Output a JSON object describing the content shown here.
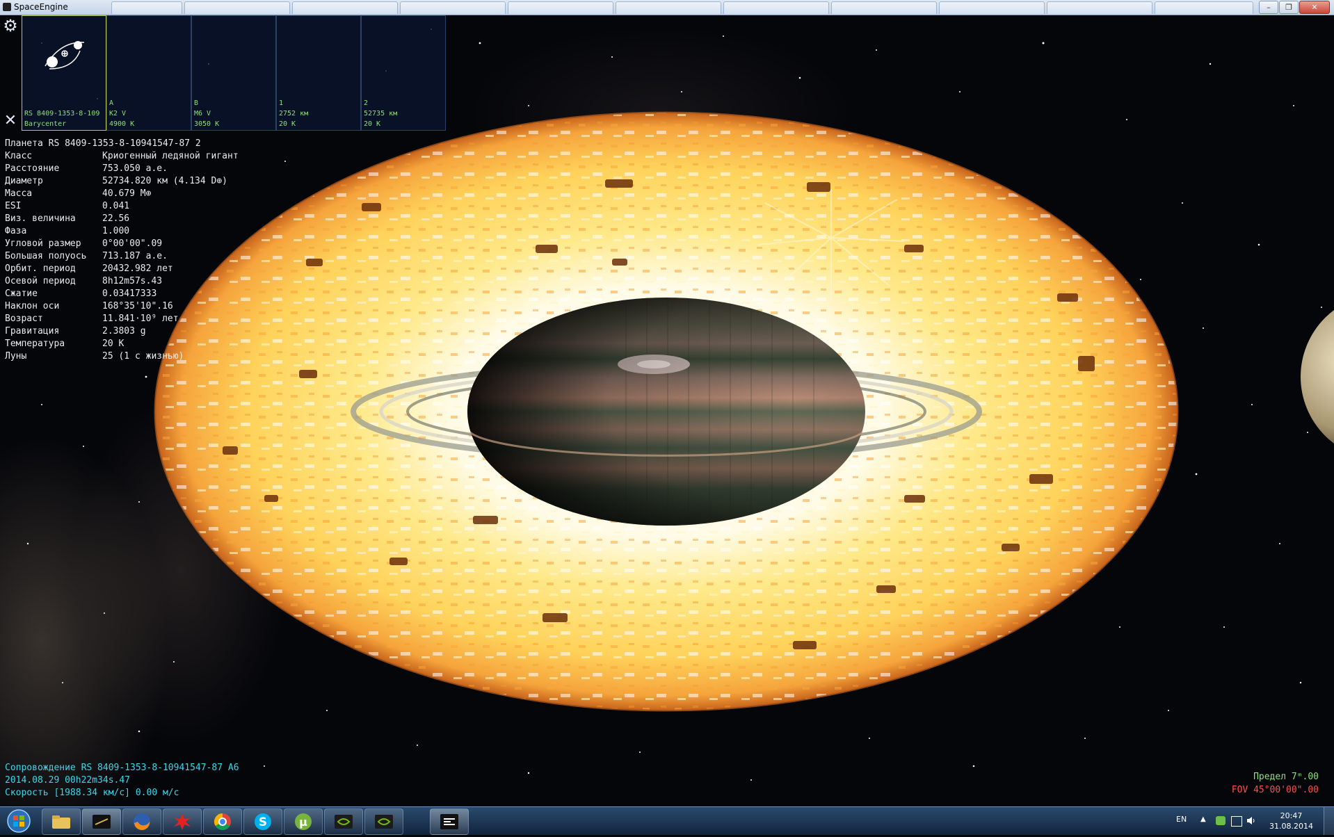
{
  "window": {
    "title": "SpaceEngine"
  },
  "selection_bar": {
    "cards": [
      {
        "l1": "",
        "l2": "RS 8409-1353-8-109",
        "l3": "Barycenter",
        "active": true
      },
      {
        "l1": "A",
        "l2": "K2 V",
        "l3": "4900 K"
      },
      {
        "l1": "B",
        "l2": "M6 V",
        "l3": "3050 K"
      },
      {
        "l1": "1",
        "l2": "2752 км",
        "l3": "20 K"
      },
      {
        "l1": "2",
        "l2": "52735 км",
        "l3": "20 K"
      }
    ]
  },
  "info": {
    "title": "Планета  RS 8409-1353-8-10941547-87 2",
    "rows": [
      {
        "key": "Класс",
        "value": "Криогенный ледяной гигант"
      },
      {
        "key": "Расстояние",
        "value": "753.050 а.е."
      },
      {
        "key": "Диаметр",
        "value": "52734.820 км (4.134 D⊕)"
      },
      {
        "key": "Масса",
        "value": "40.679 M⊕"
      },
      {
        "key": "ESI",
        "value": "0.041"
      },
      {
        "key": "Виз. величина",
        "value": "22.56"
      },
      {
        "key": "Фаза",
        "value": "1.000"
      },
      {
        "key": "Угловой размер",
        "value": "0°00'00\".09"
      },
      {
        "key": "Большая полуось",
        "value": "713.187 а.е."
      },
      {
        "key": "Орбит. период",
        "value": "20432.982 лет"
      },
      {
        "key": "Осевой период",
        "value": "8h12m57s.43"
      },
      {
        "key": "Сжатие",
        "value": "0.03417333"
      },
      {
        "key": "Наклон оси",
        "value": "168°35'10\".16"
      },
      {
        "key": "Возраст",
        "value": "11.841·10⁹ лет"
      },
      {
        "key": "Гравитация",
        "value": "2.3803 g"
      },
      {
        "key": "Температура",
        "value": "20 K"
      },
      {
        "key": "Луны",
        "value": "25 (1 с жизнью)"
      }
    ]
  },
  "hud": {
    "follow": "Сопровождение RS 8409-1353-8-10941547-87 A6",
    "datetime": "2014.08.29  00h22m34s.47",
    "speed": "Скорость [1988.34 км/с] 0.00 м/с",
    "limit": "Предел   7ᵐ.00",
    "fov": "FOV 45°00'00\".00"
  },
  "taskbar": {
    "apps": [
      "explorer-icon",
      "terminal-icon",
      "firefox-icon",
      "paint-splash-icon",
      "chrome-icon",
      "skype-icon",
      "utorrent-icon",
      "nvidia-icon",
      "nvidia-icon",
      "spaceengine-icon"
    ],
    "lang": "EN",
    "time": "20:47",
    "date": "31.08.2014"
  },
  "colors": {
    "hud_cyan": "#3dd6e8",
    "hud_green": "#8fe07f",
    "hud_red": "#ff4f4f",
    "disk_hot": "#fff3b0",
    "disk_warm": "#f0a030"
  }
}
